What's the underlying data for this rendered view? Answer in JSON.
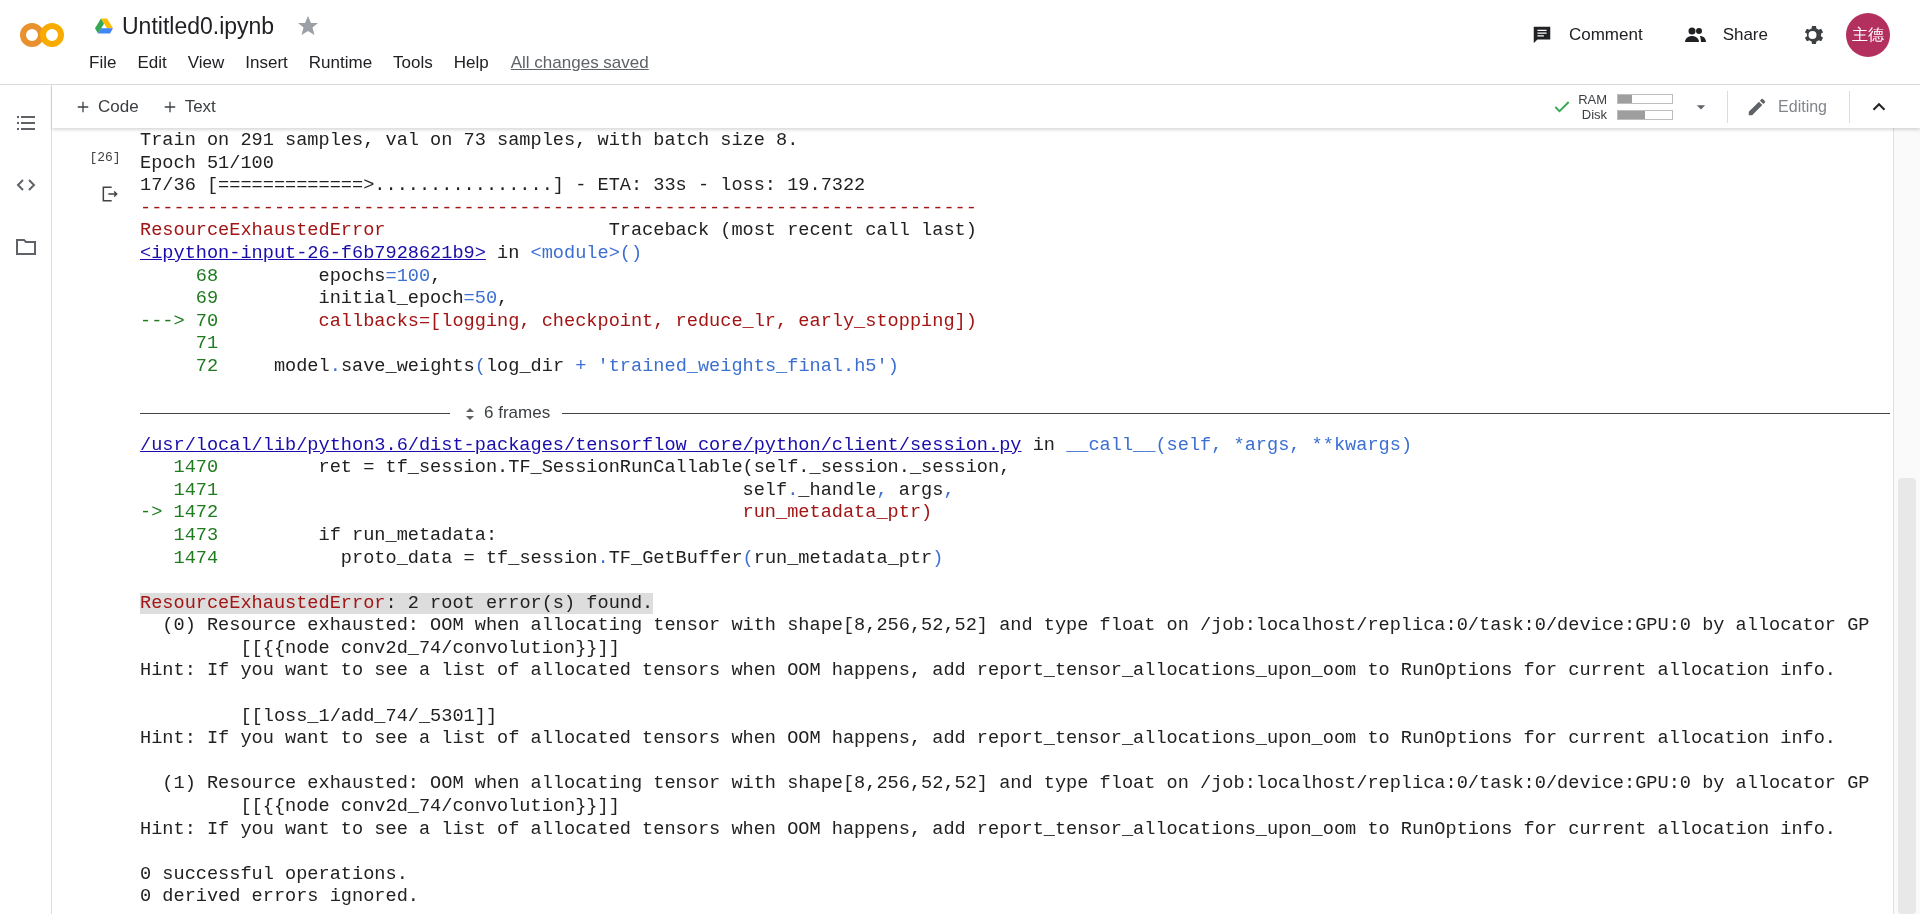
{
  "notebook": {
    "title": "Untitled0.ipynb",
    "starred": false
  },
  "menu": [
    "File",
    "Edit",
    "View",
    "Insert",
    "Runtime",
    "Tools",
    "Help"
  ],
  "save_status": "All changes saved",
  "header_actions": [
    {
      "kind": "comment",
      "label": "Comment"
    },
    {
      "kind": "share",
      "label": "Share"
    }
  ],
  "avatar": "主德",
  "toolbar": {
    "add_buttons": [
      "Code",
      "Text"
    ],
    "connected": true,
    "ram_label": "RAM",
    "ram": {
      "level": 0.25
    },
    "disk_label": "Disk",
    "disk": {
      "level": 0.5
    },
    "mode": "Editing"
  },
  "cell": {
    "execution_count": "[26]",
    "output": {
      "lines": [
        {
          "kind": "text",
          "segments": [
            {
              "kind": "plain",
              "text": "Train on 291 samples, val on 73 samples, with batch size 8."
            }
          ]
        },
        {
          "kind": "text",
          "segments": [
            {
              "kind": "plain",
              "text": "Epoch 51/100"
            }
          ]
        },
        {
          "kind": "text",
          "segments": [
            {
              "kind": "plain",
              "text": "17/36 [=============>................] - ETA: 33s - loss: 19.7322"
            }
          ]
        },
        {
          "kind": "text",
          "segments": [
            {
              "kind": "red",
              "text": "---------------------------------------------------------------------------"
            }
          ]
        },
        {
          "kind": "text",
          "segments": [
            {
              "kind": "red",
              "text": "ResourceExhaustedError"
            },
            {
              "kind": "plain",
              "text": "                    Traceback (most recent call last)"
            }
          ]
        },
        {
          "kind": "text",
          "segments": [
            {
              "kind": "link",
              "text": "<ipython-input-26-f6b7928621b9>"
            },
            {
              "kind": "plain",
              "text": " in "
            },
            {
              "kind": "blue",
              "text": "<module>()"
            }
          ]
        },
        {
          "kind": "text",
          "segments": [
            {
              "kind": "green",
              "text": "     68"
            },
            {
              "kind": "plain",
              "text": "         epochs"
            },
            {
              "kind": "blue",
              "text": "=100"
            },
            {
              "kind": "plain",
              "text": ","
            }
          ]
        },
        {
          "kind": "text",
          "segments": [
            {
              "kind": "green",
              "text": "     69"
            },
            {
              "kind": "plain",
              "text": "         initial_epoch"
            },
            {
              "kind": "blue",
              "text": "=50"
            },
            {
              "kind": "plain",
              "text": ","
            }
          ]
        },
        {
          "kind": "text",
          "segments": [
            {
              "kind": "green",
              "text": "---> 70"
            },
            {
              "kind": "red",
              "text": "         callbacks=[logging, checkpoint, reduce_lr, early_stopping])"
            }
          ]
        },
        {
          "kind": "text",
          "segments": [
            {
              "kind": "green",
              "text": "     71"
            }
          ]
        },
        {
          "kind": "text",
          "segments": [
            {
              "kind": "green",
              "text": "     72"
            },
            {
              "kind": "plain",
              "text": "     model"
            },
            {
              "kind": "blue",
              "text": "."
            },
            {
              "kind": "plain",
              "text": "save_weights"
            },
            {
              "kind": "blue",
              "text": "("
            },
            {
              "kind": "plain",
              "text": "log_dir "
            },
            {
              "kind": "blue",
              "text": "+ 'trained_weights_final.h5')"
            }
          ]
        }
      ],
      "collapsed_frames": "6 frames",
      "lines_after": [
        {
          "kind": "text",
          "segments": [
            {
              "kind": "link",
              "text": "/usr/local/lib/python3.6/dist-packages/tensorflow_core/python/client/session.py"
            },
            {
              "kind": "plain",
              "text": " in "
            },
            {
              "kind": "blue",
              "text": "__call__(self, *args, **kwargs)"
            }
          ]
        },
        {
          "kind": "text",
          "segments": [
            {
              "kind": "green",
              "text": "   1470"
            },
            {
              "kind": "plain",
              "text": "         ret = tf_session.TF_SessionRunCallable(self._session._session,"
            }
          ]
        },
        {
          "kind": "text",
          "segments": [
            {
              "kind": "green",
              "text": "   1471"
            },
            {
              "kind": "plain",
              "text": "                                               self"
            },
            {
              "kind": "blue",
              "text": "."
            },
            {
              "kind": "plain",
              "text": "_handle"
            },
            {
              "kind": "blue",
              "text": ","
            },
            {
              "kind": "plain",
              "text": " args"
            },
            {
              "kind": "blue",
              "text": ","
            }
          ]
        },
        {
          "kind": "text",
          "segments": [
            {
              "kind": "green",
              "text": "-> 1472"
            },
            {
              "kind": "red",
              "text": "                                               run_metadata_ptr)"
            }
          ]
        },
        {
          "kind": "text",
          "segments": [
            {
              "kind": "green",
              "text": "   1473"
            },
            {
              "kind": "plain",
              "text": "         if run_metadata:"
            }
          ]
        },
        {
          "kind": "text",
          "segments": [
            {
              "kind": "green",
              "text": "   1474"
            },
            {
              "kind": "plain",
              "text": "           proto_data = tf_session"
            },
            {
              "kind": "blue",
              "text": "."
            },
            {
              "kind": "plain",
              "text": "TF_GetBuffer"
            },
            {
              "kind": "blue",
              "text": "("
            },
            {
              "kind": "plain",
              "text": "run_metadata_ptr"
            },
            {
              "kind": "blue",
              "text": ")"
            }
          ]
        },
        {
          "kind": "blank"
        },
        {
          "kind": "text",
          "segments": [
            {
              "kind": "error",
              "text": "ResourceExhaustedError"
            },
            {
              "kind": "highlight",
              "text": ": 2 root error(s) found."
            }
          ]
        },
        {
          "kind": "text",
          "segments": [
            {
              "kind": "plain",
              "text": "  (0) Resource exhausted: OOM when allocating tensor with shape[8,256,52,52] and type float on /job:localhost/replica:0/task:0/device:GPU:0 by allocator GP"
            }
          ]
        },
        {
          "kind": "text",
          "segments": [
            {
              "kind": "plain",
              "text": "         [[{{node conv2d_74/convolution}}]]"
            }
          ]
        },
        {
          "kind": "text",
          "segments": [
            {
              "kind": "plain",
              "text": "Hint: If you want to see a list of allocated tensors when OOM happens, add report_tensor_allocations_upon_oom to RunOptions for current allocation info."
            }
          ]
        },
        {
          "kind": "blank"
        },
        {
          "kind": "text",
          "segments": [
            {
              "kind": "plain",
              "text": "         [[loss_1/add_74/_5301]]"
            }
          ]
        },
        {
          "kind": "text",
          "segments": [
            {
              "kind": "plain",
              "text": "Hint: If you want to see a list of allocated tensors when OOM happens, add report_tensor_allocations_upon_oom to RunOptions for current allocation info."
            }
          ]
        },
        {
          "kind": "blank"
        },
        {
          "kind": "text",
          "segments": [
            {
              "kind": "plain",
              "text": "  (1) Resource exhausted: OOM when allocating tensor with shape[8,256,52,52] and type float on /job:localhost/replica:0/task:0/device:GPU:0 by allocator GP"
            }
          ]
        },
        {
          "kind": "text",
          "segments": [
            {
              "kind": "plain",
              "text": "         [[{{node conv2d_74/convolution}}]]"
            }
          ]
        },
        {
          "kind": "text",
          "segments": [
            {
              "kind": "plain",
              "text": "Hint: If you want to see a list of allocated tensors when OOM happens, add report_tensor_allocations_upon_oom to RunOptions for current allocation info."
            }
          ]
        },
        {
          "kind": "blank"
        },
        {
          "kind": "text",
          "segments": [
            {
              "kind": "plain",
              "text": "0 successful operations."
            }
          ]
        },
        {
          "kind": "text",
          "segments": [
            {
              "kind": "plain",
              "text": "0 derived errors ignored."
            }
          ]
        }
      ]
    }
  }
}
